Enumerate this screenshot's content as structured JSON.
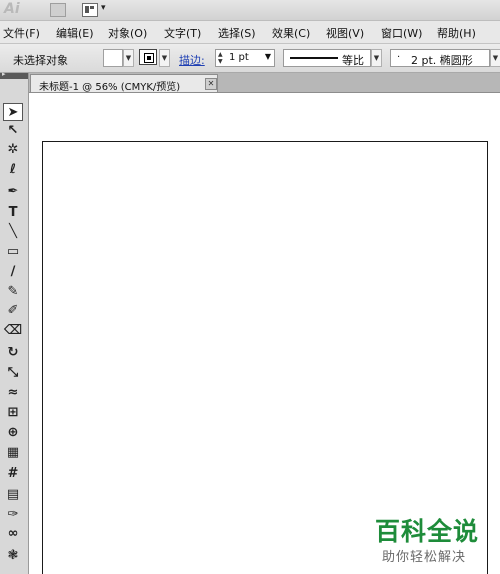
{
  "app": {
    "logo_text": "Ai"
  },
  "menu": [
    "文件(F)",
    "编辑(E)",
    "对象(O)",
    "文字(T)",
    "选择(S)",
    "效果(C)",
    "视图(V)",
    "窗口(W)",
    "帮助(H)"
  ],
  "control": {
    "selection_label": "未选择对象",
    "stroke_link": "描边:",
    "stroke_weight": "1 pt",
    "profile_label": "等比",
    "brush_label": "2 pt. 椭圆形"
  },
  "document": {
    "tab_label": "未标题-1 @ 56% (CMYK/预览)",
    "close_glyph": "✕"
  },
  "tools": [
    {
      "name": "selection-tool-icon",
      "glyph": "➤"
    },
    {
      "name": "direct-selection-tool-icon",
      "glyph": "↖"
    },
    {
      "name": "magic-wand-tool-icon",
      "glyph": "✲"
    },
    {
      "name": "lasso-tool-icon",
      "glyph": "ℓ"
    },
    {
      "name": "pen-tool-icon",
      "glyph": "✒"
    },
    {
      "name": "type-tool-icon",
      "glyph": "T"
    },
    {
      "name": "line-tool-icon",
      "glyph": "╲"
    },
    {
      "name": "rectangle-tool-icon",
      "glyph": "▭"
    },
    {
      "name": "paintbrush-tool-icon",
      "glyph": "∕"
    },
    {
      "name": "pencil-tool-icon",
      "glyph": "✎"
    },
    {
      "name": "blob-brush-tool-icon",
      "glyph": "✐"
    },
    {
      "name": "eraser-tool-icon",
      "glyph": "⌫"
    },
    {
      "name": "rotate-tool-icon",
      "glyph": "↻"
    },
    {
      "name": "scale-tool-icon",
      "glyph": "⤡"
    },
    {
      "name": "warp-tool-icon",
      "glyph": "≈"
    },
    {
      "name": "free-transform-tool-icon",
      "glyph": "⊞"
    },
    {
      "name": "shape-builder-tool-icon",
      "glyph": "⊕"
    },
    {
      "name": "perspective-grid-tool-icon",
      "glyph": "▦"
    },
    {
      "name": "mesh-tool-icon",
      "glyph": "#"
    },
    {
      "name": "gradient-tool-icon",
      "glyph": "▤"
    },
    {
      "name": "eyedropper-tool-icon",
      "glyph": "✑"
    },
    {
      "name": "blend-tool-icon",
      "glyph": "∞"
    },
    {
      "name": "symbol-sprayer-tool-icon",
      "glyph": "❃"
    }
  ],
  "watermark": {
    "title": "百科全说",
    "subtitle": "助你轻松解决"
  }
}
